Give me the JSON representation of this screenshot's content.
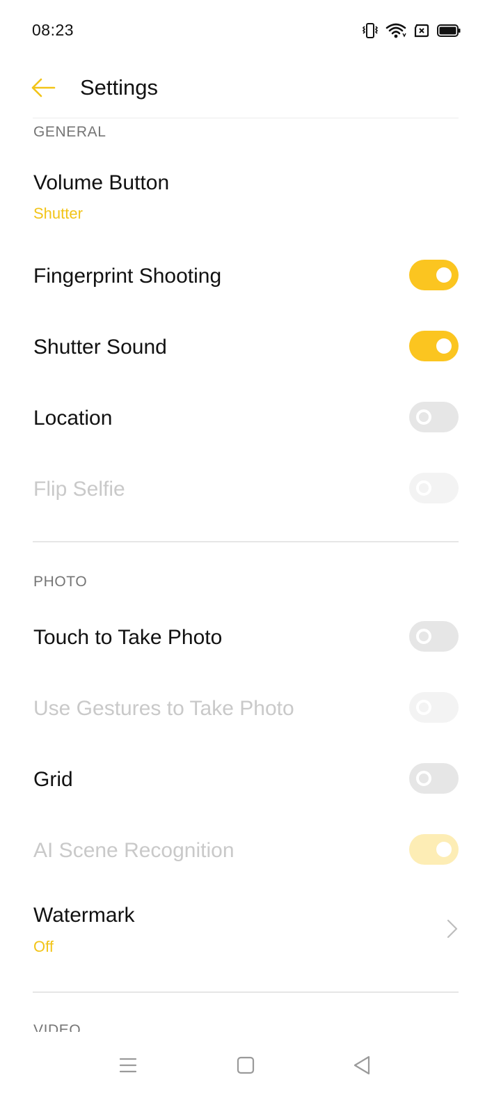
{
  "status": {
    "time": "08:23",
    "icons": [
      "vibrate-icon",
      "wifi-icon",
      "sim-x-icon",
      "battery-icon"
    ]
  },
  "appbar": {
    "title": "Settings",
    "back_icon": "arrow-left-icon"
  },
  "colors": {
    "accent": "#fbc520",
    "accent_text": "#f2c418",
    "toggle_off": "#e6e6e6",
    "disabled_text": "#c9c9c9",
    "section_text": "#757575"
  },
  "sections": {
    "general": {
      "header": "GENERAL",
      "items": [
        {
          "label": "Volume Button",
          "value": "Shutter"
        },
        {
          "label": "Fingerprint Shooting",
          "toggle": true,
          "enabled": true
        },
        {
          "label": "Shutter Sound",
          "toggle": true,
          "enabled": true
        },
        {
          "label": "Location",
          "toggle": false,
          "enabled": true
        },
        {
          "label": "Flip Selfie",
          "toggle": false,
          "enabled": false
        }
      ]
    },
    "photo": {
      "header": "PHOTO",
      "items": [
        {
          "label": "Touch to Take Photo",
          "toggle": false,
          "enabled": true
        },
        {
          "label": "Use Gestures to Take Photo",
          "toggle": false,
          "enabled": false
        },
        {
          "label": "Grid",
          "toggle": false,
          "enabled": true
        },
        {
          "label": "AI Scene Recognition",
          "toggle": true,
          "enabled": false
        },
        {
          "label": "Watermark",
          "value": "Off"
        }
      ]
    },
    "video": {
      "header": "VIDEO"
    }
  },
  "navbar": {
    "buttons": [
      "menu-icon",
      "home-square-icon",
      "back-triangle-icon"
    ]
  }
}
